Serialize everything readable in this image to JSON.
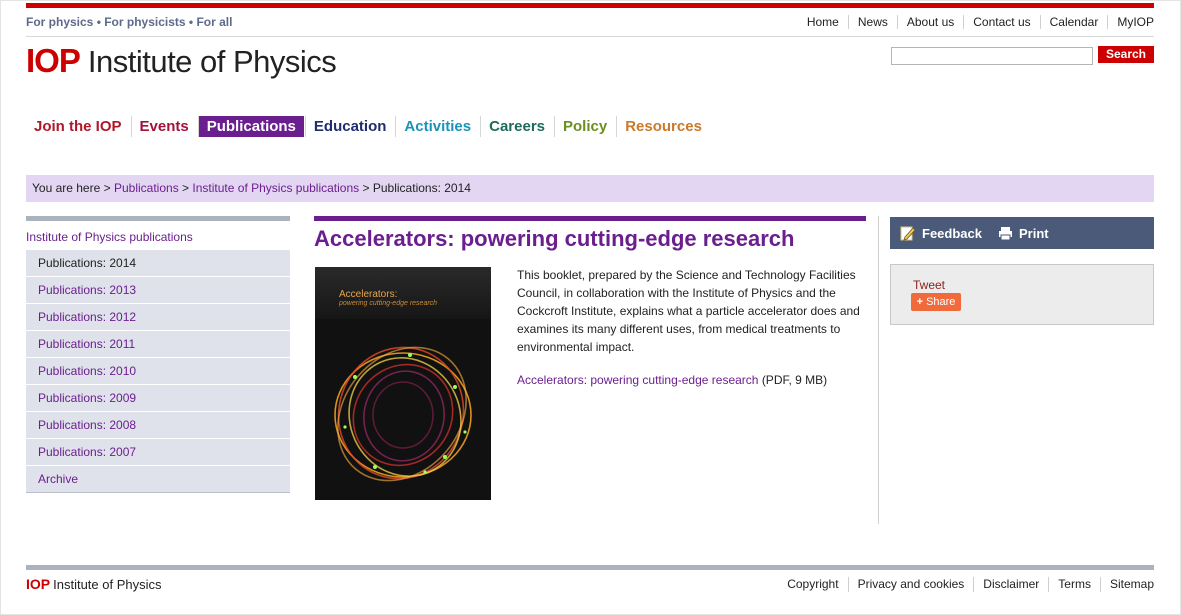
{
  "header": {
    "tagline": "For physics • For physicists • For all",
    "top_links": [
      "Home",
      "News",
      "About us",
      "Contact us",
      "Calendar",
      "MyIOP"
    ],
    "logo_short": "IOP",
    "logo_name": "Institute of Physics",
    "search_button": "Search",
    "search_value": ""
  },
  "nav": [
    {
      "label": "Join the IOP",
      "color": "#b0172b"
    },
    {
      "label": "Events",
      "color": "#a3123b"
    },
    {
      "label": "Publications",
      "color": "#ffffff",
      "bg": "#6b1f8f",
      "active": true
    },
    {
      "label": "Education",
      "color": "#1f2d6e"
    },
    {
      "label": "Activities",
      "color": "#1b93b8"
    },
    {
      "label": "Careers",
      "color": "#1e6b5c"
    },
    {
      "label": "Policy",
      "color": "#6a8f1e"
    },
    {
      "label": "Resources",
      "color": "#c97a2c"
    }
  ],
  "breadcrumb": {
    "prefix": "You are here",
    "sep": ">",
    "items": [
      "Publications",
      "Institute of Physics publications"
    ],
    "current": "Publications: 2014"
  },
  "sidebar": {
    "title": "Institute of Physics publications",
    "items": [
      "Publications: 2014",
      "Publications: 2013",
      "Publications: 2012",
      "Publications: 2011",
      "Publications: 2010",
      "Publications: 2009",
      "Publications: 2008",
      "Publications: 2007",
      "Archive"
    ],
    "current_index": 0
  },
  "main": {
    "heading": "Accelerators: powering cutting-edge research",
    "cover_title": "Accelerators:",
    "cover_subtitle": "powering cutting-edge research",
    "description": "This booklet, prepared by the Science and Technology Facilities Council, in collaboration with the Institute of Physics and the Cockcroft Institute, explains what a particle accelerator does and examines its many different uses, from medical treatments to environmental impact.",
    "pdf_link": "Accelerators: powering cutting-edge research",
    "pdf_meta": "(PDF, 9 MB)"
  },
  "tools": {
    "feedback": "Feedback",
    "print": "Print",
    "tweet": "Tweet",
    "share": "Share"
  },
  "footer": {
    "logo_short": "IOP",
    "logo_name": "Institute of Physics",
    "links": [
      "Copyright",
      "Privacy and cookies",
      "Disclaimer",
      "Terms",
      "Sitemap"
    ]
  }
}
